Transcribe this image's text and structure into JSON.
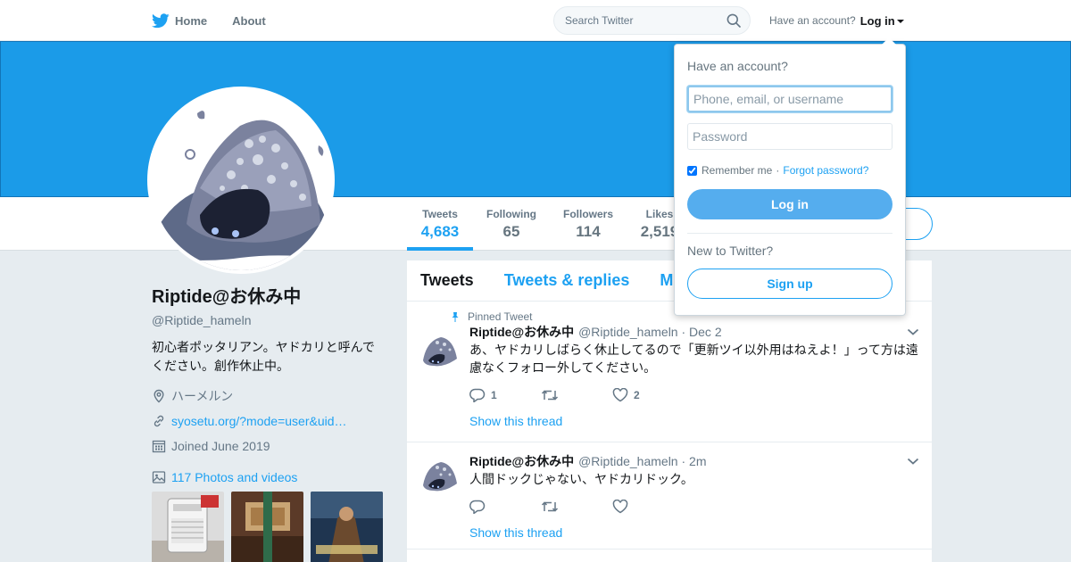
{
  "nav": {
    "home": "Home",
    "about": "About",
    "search_placeholder": "Search Twitter",
    "have_account": "Have an account?",
    "login": "Log in"
  },
  "profile": {
    "name": "Riptide@お休み中",
    "handle": "@Riptide_hameln",
    "bio_line1": "初心者ポッタリアン。ヤドカリと呼んで",
    "bio_line2": "ください。創作休止中。",
    "location": "ハーメルン",
    "url": "syosetu.org/?mode=user&uid…",
    "joined": "Joined June 2019",
    "photos": "117 Photos and videos"
  },
  "stats": [
    {
      "label": "Tweets",
      "value": "4,683"
    },
    {
      "label": "Following",
      "value": "65"
    },
    {
      "label": "Followers",
      "value": "114"
    },
    {
      "label": "Likes",
      "value": "2,519"
    }
  ],
  "timeline": {
    "tabs": [
      "Tweets",
      "Tweets & replies",
      "Media"
    ],
    "pinned_label": "Pinned Tweet",
    "tweets": [
      {
        "name": "Riptide@お休み中",
        "meta": "@Riptide_hameln · Dec 2",
        "text": "あ、ヤドカリしばらく休止してるので「更新ツイ以外用はねえよ！」って方は遠慮なくフォロー外してください。",
        "replies": "1",
        "retweets": "",
        "likes": "2",
        "thread": "Show this thread"
      },
      {
        "name": "Riptide@お休み中",
        "meta": "@Riptide_hameln · 2m",
        "text": "人間ドックじゃない、ヤドカリドック。",
        "replies": "",
        "retweets": "",
        "likes": "",
        "thread": "Show this thread"
      }
    ]
  },
  "login": {
    "title": "Have an account?",
    "user_placeholder": "Phone, email, or username",
    "password_placeholder": "Password",
    "remember": "Remember me",
    "sep": "·",
    "forgot": "Forgot password?",
    "login_button": "Log in",
    "new_to": "New to Twitter?",
    "signup_button": "Sign up"
  },
  "colors": {
    "accent": "#1da1f2",
    "banner": "#1b9be8"
  }
}
